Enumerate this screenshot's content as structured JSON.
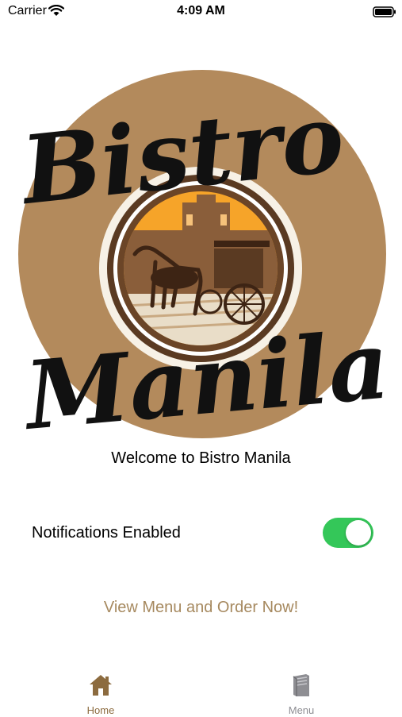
{
  "status_bar": {
    "carrier": "Carrier",
    "time": "4:09 AM"
  },
  "logo": {
    "line1": "Bistro",
    "line2": "Manila"
  },
  "welcome_text": "Welcome to Bistro Manila",
  "notifications": {
    "label": "Notifications Enabled",
    "enabled": true
  },
  "cta_label": "View Menu and Order Now!",
  "tab_bar": {
    "home_label": "Home",
    "menu_label": "Menu",
    "active": "Home"
  },
  "colors": {
    "brand_brown": "#a6895f",
    "logo_circle": "#b38a5c",
    "accent_orange": "#f6a429",
    "toggle_on": "#34c759",
    "tab_active": "#8c6b3f",
    "tab_inactive": "#8e8e93"
  }
}
